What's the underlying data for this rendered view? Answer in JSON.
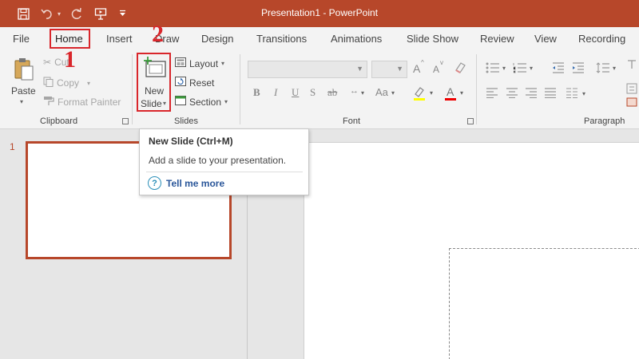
{
  "window": {
    "title": "Presentation1  -  PowerPoint"
  },
  "qat": {
    "save_icon": "save-icon",
    "undo_icon": "undo-icon",
    "redo_icon": "redo-icon",
    "present_icon": "present-from-beginning-icon",
    "customize_icon": "customize-toolbar-icon"
  },
  "tabs": [
    {
      "label": "File"
    },
    {
      "label": "Home",
      "active": true
    },
    {
      "label": "Insert"
    },
    {
      "label": "Draw"
    },
    {
      "label": "Design"
    },
    {
      "label": "Transitions"
    },
    {
      "label": "Animations"
    },
    {
      "label": "Slide Show"
    },
    {
      "label": "Review"
    },
    {
      "label": "View"
    },
    {
      "label": "Recording"
    }
  ],
  "ribbon": {
    "clipboard": {
      "label": "Clipboard",
      "paste": "Paste",
      "cut": "Cut",
      "copy": "Copy",
      "format_painter": "Format Painter"
    },
    "slides": {
      "label": "Slides",
      "new_line1": "New",
      "new_line2": "Slide",
      "layout": "Layout",
      "reset": "Reset",
      "section": "Section"
    },
    "font": {
      "label": "Font",
      "bold": "B",
      "italic": "I",
      "underline": "U",
      "strike": "S",
      "spacing": "ab",
      "case": "Aa",
      "grow": "A",
      "shrink": "A",
      "color_a": "A"
    },
    "paragraph": {
      "label": "Paragraph"
    }
  },
  "annotations": {
    "step1": "1",
    "step2": "2"
  },
  "tooltip": {
    "title": "New Slide (Ctrl+M)",
    "description": "Add a slide to your presentation.",
    "help_symbol": "?",
    "tell_me_more": "Tell me more"
  },
  "thumbnails": [
    {
      "number": "1"
    }
  ],
  "colors": {
    "titlebar": "#b7472a",
    "accent": "#b7472a",
    "annotation_red": "#d9262b",
    "help_link": "#2b579a"
  }
}
